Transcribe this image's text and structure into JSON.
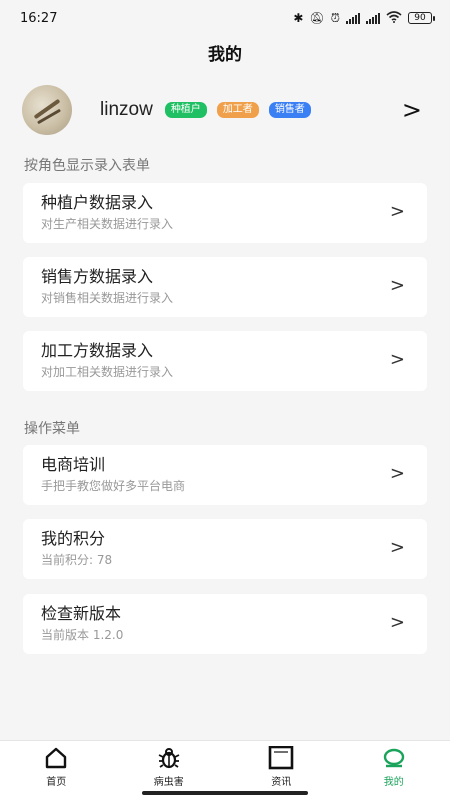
{
  "status_bar": {
    "time": "16:27",
    "icons": [
      "bluetooth-icon",
      "mute-icon",
      "alarm-icon",
      "signal-icon",
      "signal-icon",
      "wifi-icon"
    ],
    "battery": "90"
  },
  "header": {
    "title": "我的"
  },
  "profile": {
    "username": "linzow",
    "tags": [
      {
        "label": "种植户",
        "color": "#1fbf63"
      },
      {
        "label": "加工者",
        "color": "#f0a04b"
      },
      {
        "label": "销售者",
        "color": "#3b7ff5"
      }
    ],
    "arrow": ">"
  },
  "sections": {
    "role_forms": {
      "title": "按角色显示录入表单",
      "items": [
        {
          "title": "种植户数据录入",
          "subtitle": "对生产相关数据进行录入"
        },
        {
          "title": "销售方数据录入",
          "subtitle": "对销售相关数据进行录入"
        },
        {
          "title": "加工方数据录入",
          "subtitle": "对加工相关数据进行录入"
        }
      ]
    },
    "menu": {
      "title": "操作菜单",
      "items": [
        {
          "title": "电商培训",
          "subtitle": "手把手教您做好多平台电商"
        },
        {
          "title": "我的积分",
          "subtitle": "当前积分: 78"
        },
        {
          "title": "检查新版本",
          "subtitle": "当前版本 1.2.0"
        }
      ]
    }
  },
  "card_arrow": ">",
  "bottom_nav": [
    {
      "label": "首页",
      "icon": "home-icon"
    },
    {
      "label": "病虫害",
      "icon": "bug-icon"
    },
    {
      "label": "资讯",
      "icon": "news-icon"
    },
    {
      "label": "我的",
      "icon": "profile-icon",
      "active": true
    }
  ],
  "colors": {
    "accent": "#1aa35b",
    "background": "#f5f5f5"
  }
}
